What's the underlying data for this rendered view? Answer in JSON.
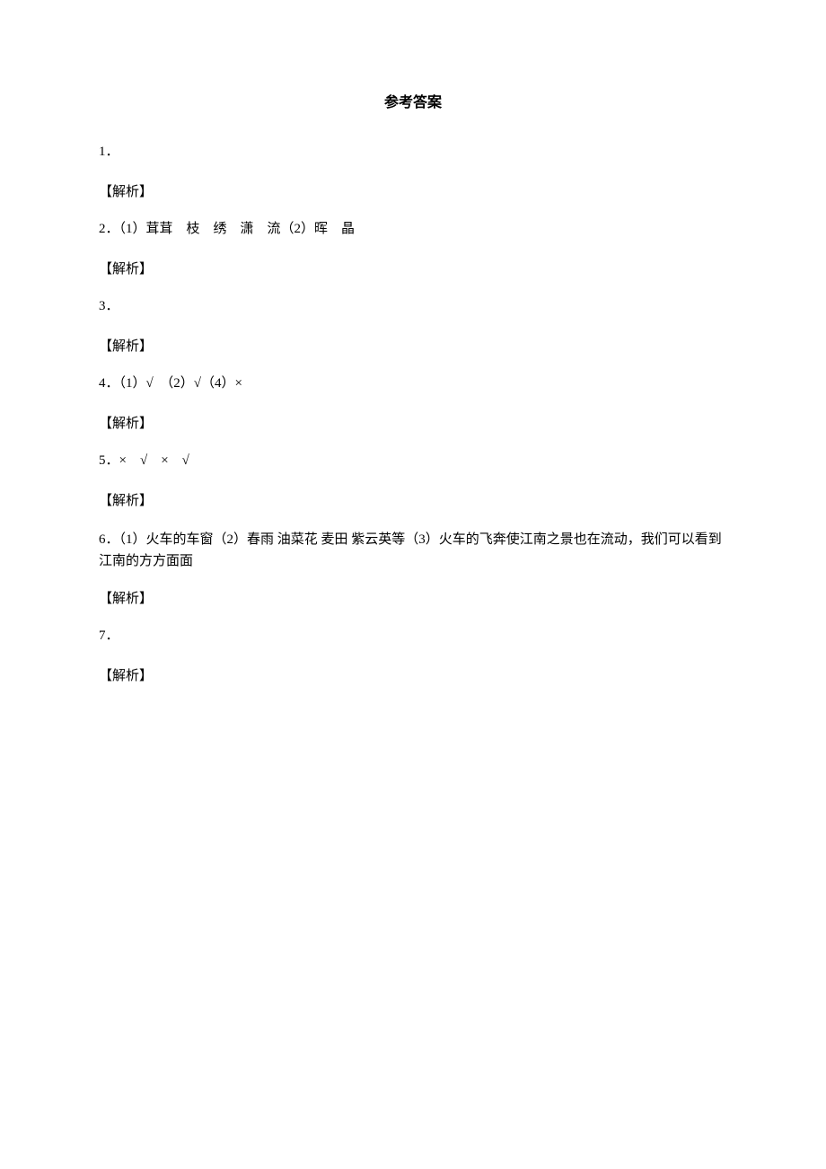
{
  "title": "参考答案",
  "answers": {
    "item1": {
      "number": "1．",
      "content": "",
      "explain": "【解析】"
    },
    "item2": {
      "number": "2．",
      "content": "（1）茸茸　枝　绣　潇　流（2）晖　晶",
      "explain": "【解析】"
    },
    "item3": {
      "number": "3．",
      "content": "",
      "explain": "【解析】"
    },
    "item4": {
      "number": "4．",
      "content": "（1）√　（2）√（4）×",
      "explain": "【解析】"
    },
    "item5": {
      "number": "5．",
      "content": "×　√　×　√",
      "explain": "【解析】"
    },
    "item6": {
      "number": "6．",
      "content": "（1）火车的车窗（2）春雨 油菜花 麦田 紫云英等（3）火车的飞奔使江南之景也在流动，我们可以看到江南的方方面面",
      "explain": "【解析】"
    },
    "item7": {
      "number": "7．",
      "content": "",
      "explain": "【解析】"
    }
  }
}
